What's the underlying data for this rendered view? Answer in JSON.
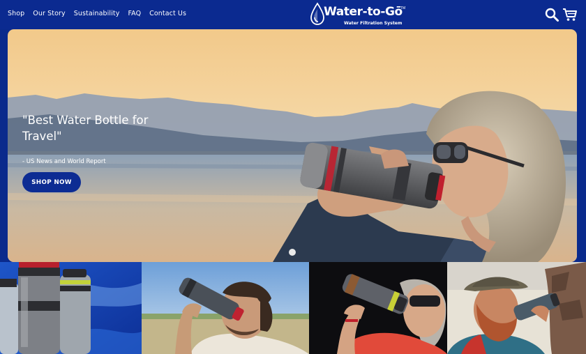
{
  "nav": {
    "items": [
      {
        "label": "Shop"
      },
      {
        "label": "Our Story"
      },
      {
        "label": "Sustainability"
      },
      {
        "label": "FAQ"
      },
      {
        "label": "Contact Us"
      }
    ]
  },
  "logo": {
    "name": "Water-to-Gō",
    "trademark": "TM",
    "tagline": "Water Filtration System"
  },
  "header_icons": [
    "search-icon",
    "cart-icon"
  ],
  "hero": {
    "quote": "\"Best Water Bottle for Travel\"",
    "attribution": "- US News and World Report",
    "cta_label": "SHOP NOW",
    "slide_count": 1
  },
  "colors": {
    "brand_navy": "#0b2a90",
    "button_navy": "#0d2c93",
    "white": "#ffffff"
  }
}
